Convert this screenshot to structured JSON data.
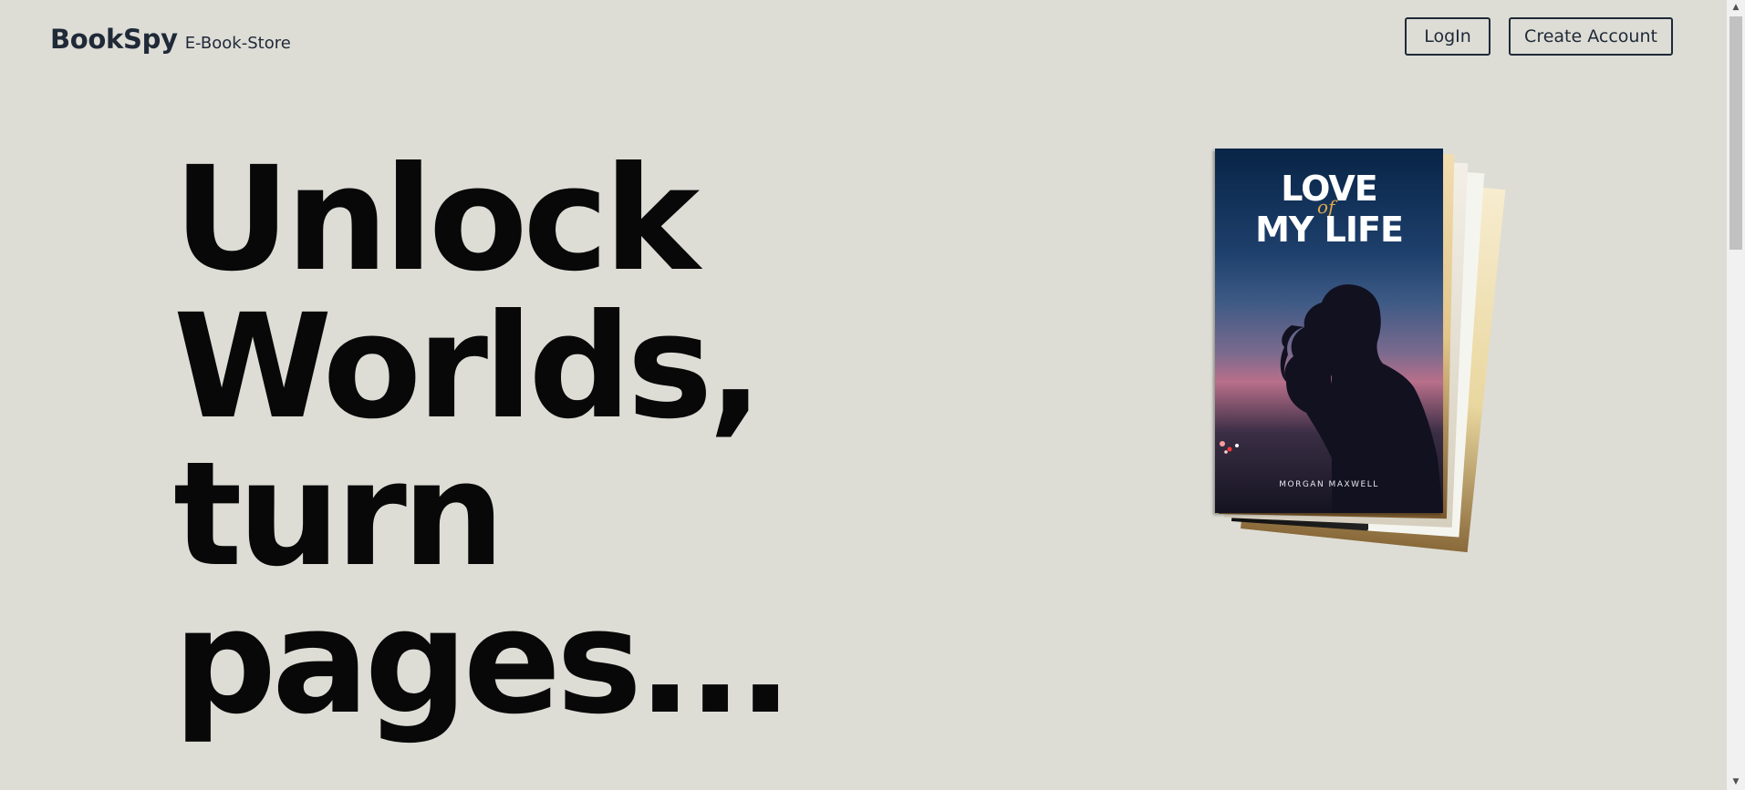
{
  "header": {
    "brand_name": "BookSpy",
    "brand_tagline": "E-Book-Store",
    "login_label": "LogIn",
    "create_account_label": "Create Account"
  },
  "hero": {
    "lines": [
      "Unlock",
      "Worlds,",
      "turn",
      "pages..."
    ]
  },
  "book_cover": {
    "title_line1": "LOVE",
    "title_of": "of",
    "title_line2": "MY LIFE",
    "author": "MORGAN MAXWELL"
  },
  "colors": {
    "background": "#ddddd6",
    "text_dark": "#1f2937",
    "hero_text": "#080808",
    "cover_accent": "#e0a84a"
  },
  "icons": {
    "scroll_up": "triangle-up",
    "scroll_down": "triangle-down"
  }
}
